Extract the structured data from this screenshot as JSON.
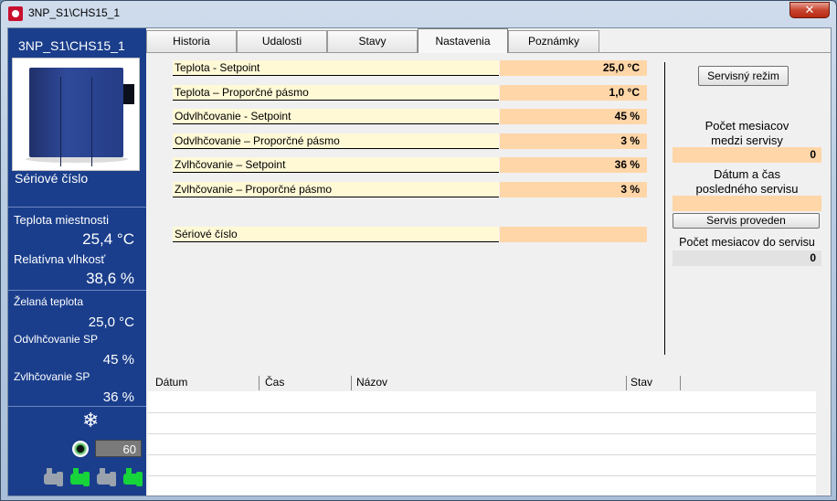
{
  "window": {
    "title": "3NP_S1\\CHS15_1",
    "close_label": "✕"
  },
  "left_panel": {
    "unit_name": "3NP_S1\\CHS15_1",
    "serial_label": "Sériové číslo",
    "room_temp_label": "Teplota miestnosti",
    "room_temp_value": "25,4 °C",
    "humidity_label": "Relatívna vlhkosť",
    "humidity_value": "38,6 %",
    "desired_temp_label": "Želaná teplota",
    "desired_temp_value": "25,0 °C",
    "dehum_sp_label": "Odvlhčovanie SP",
    "dehum_sp_value": "45 %",
    "hum_sp_label": "Zvlhčovanie SP",
    "hum_sp_value": "36 %",
    "snow_icon": "❄",
    "fan_value": "60",
    "pumps": [
      {
        "state": "off"
      },
      {
        "state": "on"
      },
      {
        "state": "off"
      },
      {
        "state": "on"
      }
    ]
  },
  "tabs": [
    {
      "label": "Historia"
    },
    {
      "label": "Udalosti"
    },
    {
      "label": "Stavy"
    },
    {
      "label": "Nastavenia",
      "active": true
    },
    {
      "label": "Poznámky"
    }
  ],
  "settings": [
    {
      "label": "Teplota - Setpoint",
      "value": "25,0 °C"
    },
    {
      "label": "Teplota – Proporčné pásmo",
      "value": "1,0 °C"
    },
    {
      "label": "Odvlhčovanie - Setpoint",
      "value": "45 %"
    },
    {
      "label": "Odvlhčovanie – Proporčné pásmo",
      "value": "3 %"
    },
    {
      "label": "Zvlhčovanie – Setpoint",
      "value": "36 %"
    },
    {
      "label": "Zvlhčovanie – Proporčné pásmo",
      "value": "3 %"
    }
  ],
  "serial_row": {
    "label": "Sériové číslo",
    "value": ""
  },
  "service": {
    "mode_button": "Servisný režim",
    "months_between_label1": "Počet mesiacov",
    "months_between_label2": "medzi servisy",
    "months_between_value": "0",
    "last_service_label1": "Dátum a čas",
    "last_service_label2": "posledného servisu",
    "last_service_value": "",
    "done_button": "Servis proveden",
    "months_to_label": "Počet mesiacov do servisu",
    "months_to_value": "0"
  },
  "table": {
    "columns": [
      "Dátum",
      "Čas",
      "Názov",
      "Stav"
    ],
    "rows": []
  }
}
